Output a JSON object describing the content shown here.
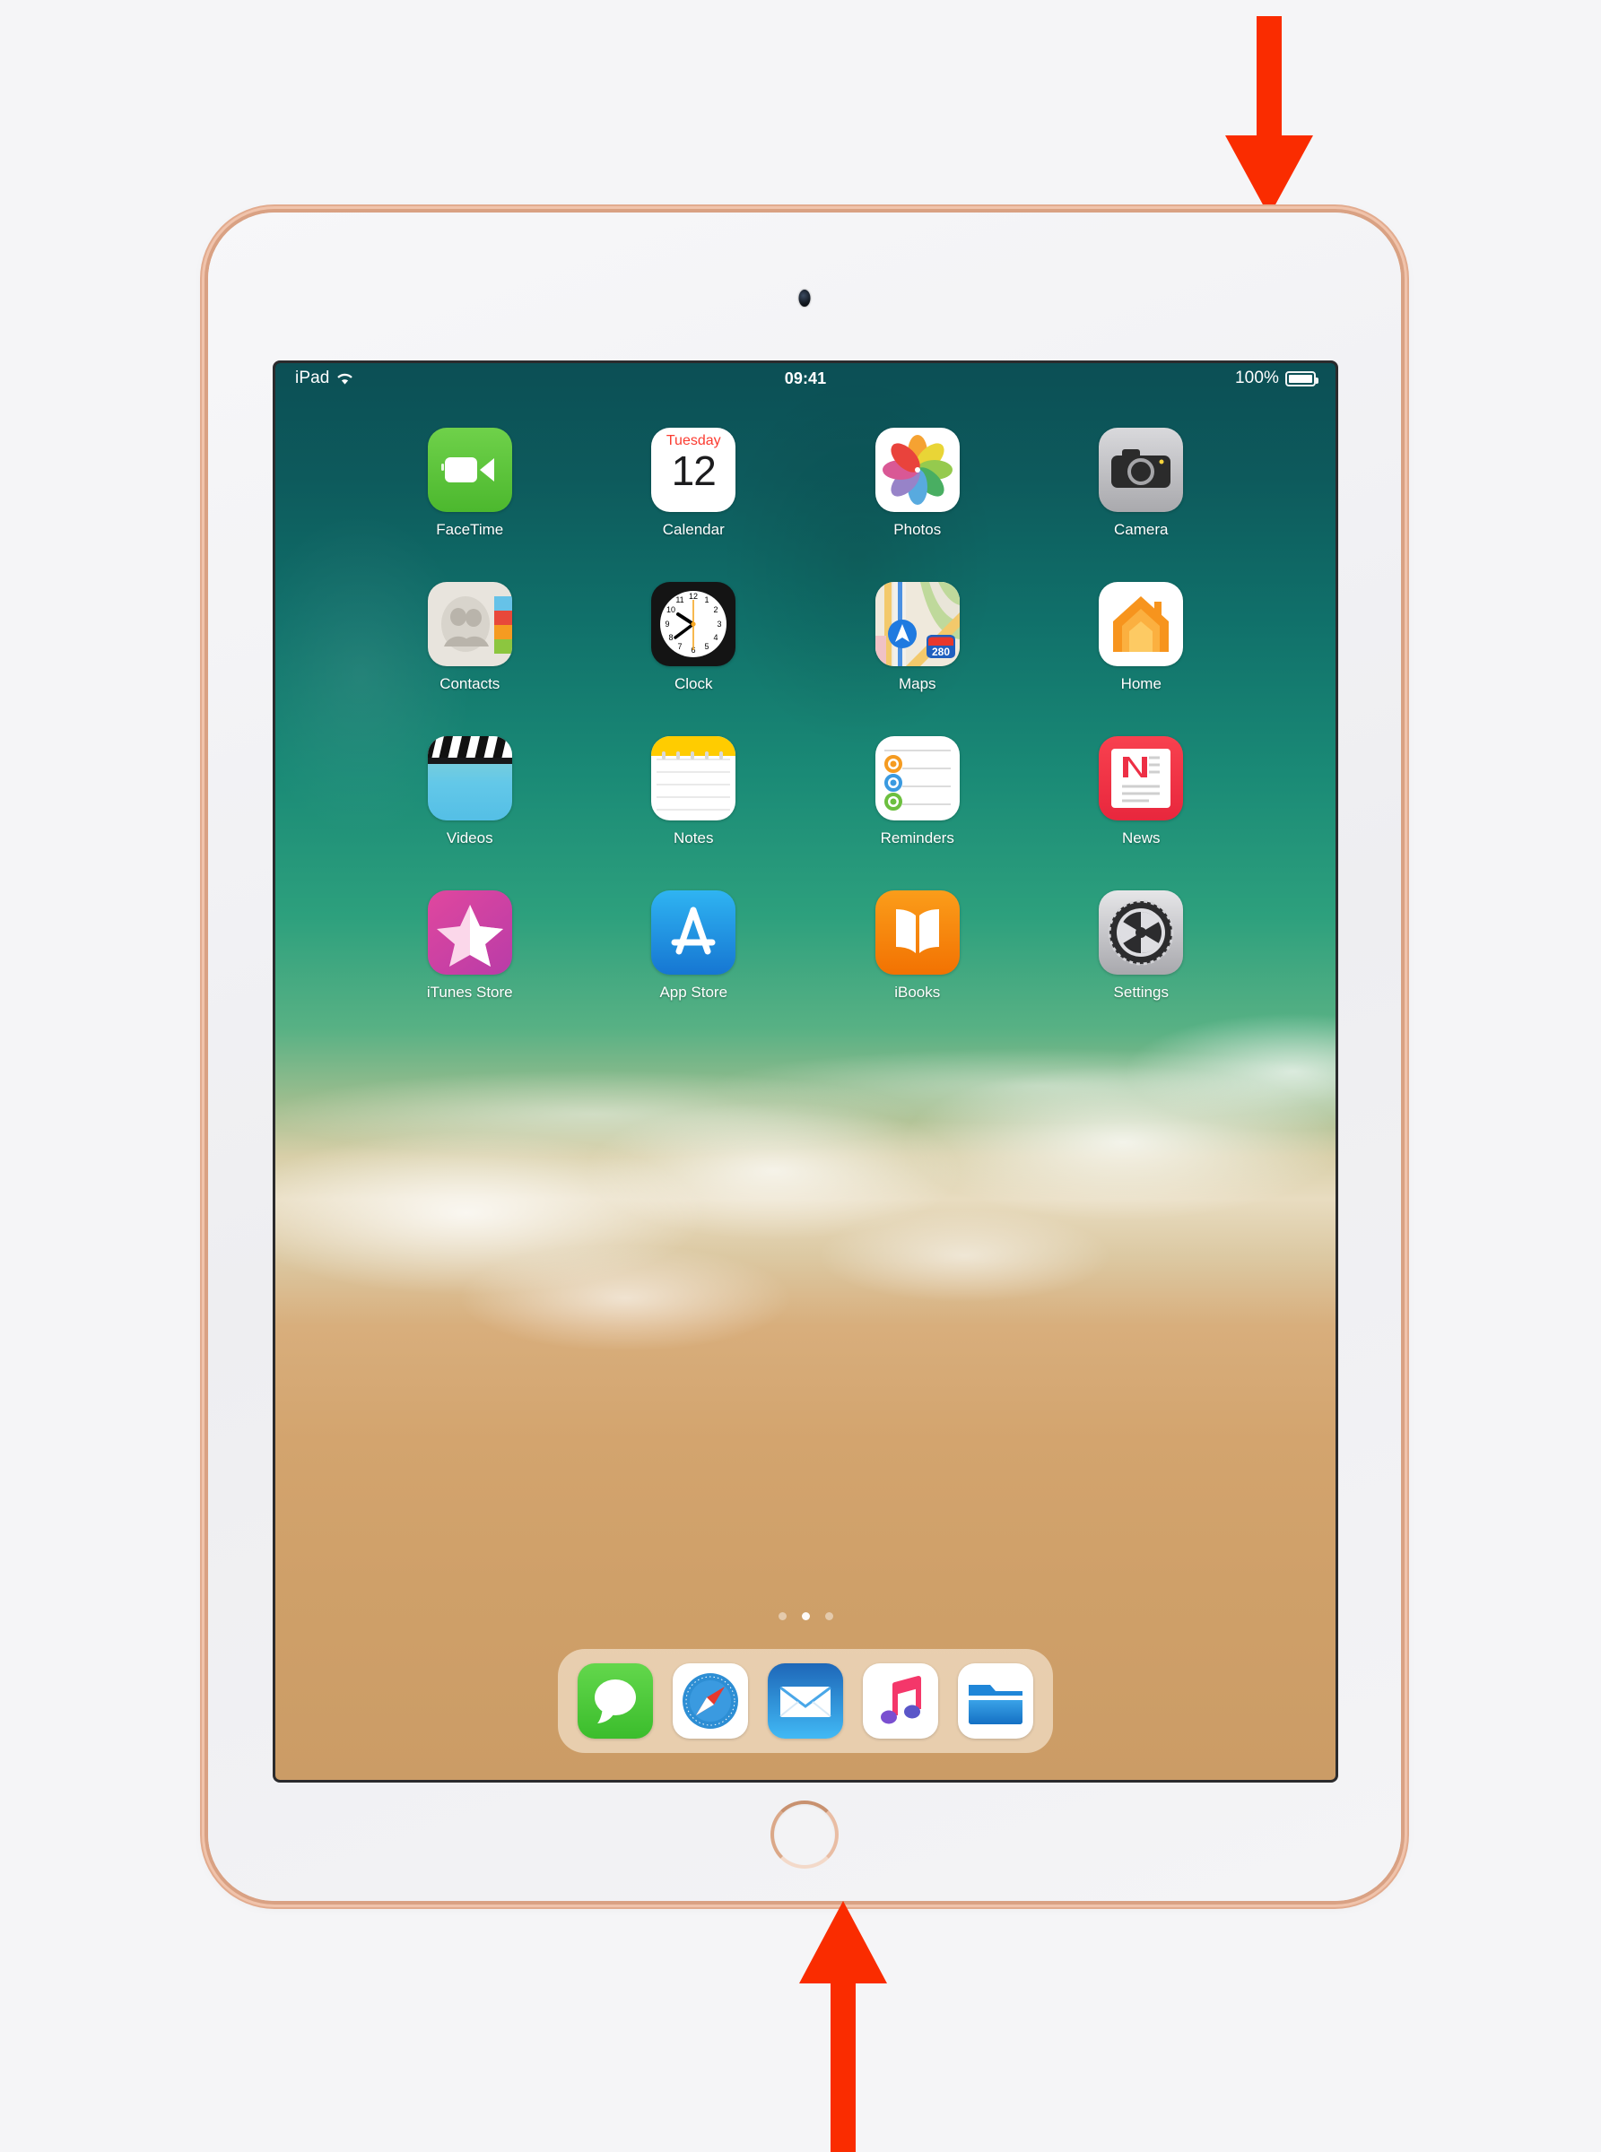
{
  "device": {
    "name": "iPad",
    "finish_color": "#e2ab8e",
    "body_color": "#f3f3f5",
    "camera_icon": "front-camera",
    "home_button_label": "Home button"
  },
  "annotations": {
    "arrow_color": "#fa2c00",
    "top_arrow": {
      "direction": "down",
      "points_at": "top-edge-power-button"
    },
    "bottom_arrow": {
      "direction": "up",
      "points_at": "home-button"
    }
  },
  "status_bar": {
    "carrier": "iPad",
    "wifi_icon": "wifi-icon",
    "time": "09:41",
    "battery_percent": "100%",
    "battery_level": 100,
    "battery_icon": "battery-full-icon"
  },
  "home_screen": {
    "wallpaper": "ios11-beach-wave",
    "apps": [
      {
        "label": "FaceTime",
        "icon": "facetime-icon",
        "color": "#4cb82e"
      },
      {
        "label": "Calendar",
        "icon": "calendar-icon",
        "color": "#ffffff",
        "day": "Tuesday",
        "date": "12"
      },
      {
        "label": "Photos",
        "icon": "photos-icon",
        "color": "#ffffff"
      },
      {
        "label": "Camera",
        "icon": "camera-icon",
        "color": "#a9a9ad"
      },
      {
        "label": "Contacts",
        "icon": "contacts-icon",
        "color": "#e8e4dd"
      },
      {
        "label": "Clock",
        "icon": "clock-icon",
        "color": "#141414"
      },
      {
        "label": "Maps",
        "icon": "maps-icon",
        "color": "#e9e3d6",
        "shield": "280"
      },
      {
        "label": "Home",
        "icon": "home-app-icon",
        "color": "#f7941d"
      },
      {
        "label": "Videos",
        "icon": "videos-icon",
        "color": "#54bfe6"
      },
      {
        "label": "Notes",
        "icon": "notes-icon",
        "color": "#ffcc00"
      },
      {
        "label": "Reminders",
        "icon": "reminders-icon",
        "color": "#ffffff"
      },
      {
        "label": "News",
        "icon": "news-icon",
        "color": "#e8273d"
      },
      {
        "label": "iTunes Store",
        "icon": "itunes-store-icon",
        "color": "#b93ca8"
      },
      {
        "label": "App Store",
        "icon": "app-store-icon",
        "color": "#1676d2"
      },
      {
        "label": "iBooks",
        "icon": "ibooks-icon",
        "color": "#f27202"
      },
      {
        "label": "Settings",
        "icon": "settings-icon",
        "color": "#a8a8ad"
      }
    ],
    "page_dots": {
      "count": 3,
      "active_index": 1
    },
    "dock": [
      {
        "label": "Messages",
        "icon": "messages-icon",
        "color": "#3bbd2c"
      },
      {
        "label": "Safari",
        "icon": "safari-icon",
        "color": "#1e88e5"
      },
      {
        "label": "Mail",
        "icon": "mail-icon",
        "color": "#41b9f5"
      },
      {
        "label": "Music",
        "icon": "music-icon",
        "color": "#fa2b56"
      },
      {
        "label": "Files",
        "icon": "files-icon",
        "color": "#2196f3"
      }
    ]
  }
}
